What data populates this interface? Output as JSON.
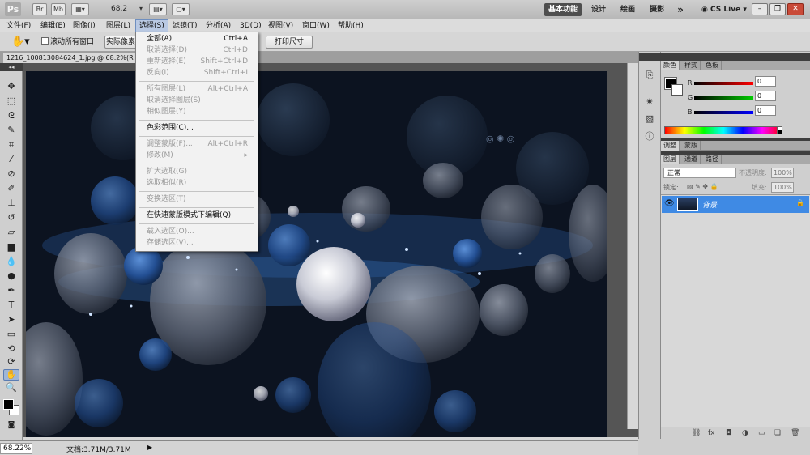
{
  "appbar": {
    "logo": "Ps",
    "br_label": "Br",
    "mb_label": "Mb",
    "zoom": "68.2",
    "workspaces": [
      "基本功能",
      "设计",
      "绘画",
      "摄影"
    ],
    "more": "»",
    "cslive": "CS Live"
  },
  "menubar": {
    "items": [
      "文件(F)",
      "编辑(E)",
      "图像(I)",
      "图层(L)",
      "选择(S)",
      "滤镜(T)",
      "分析(A)",
      "3D(D)",
      "视图(V)",
      "窗口(W)",
      "帮助(H)"
    ]
  },
  "options": {
    "scroll_all_windows": "滚动所有窗口",
    "actual_pixels": "实际像素",
    "print_size": "打印尺寸"
  },
  "document": {
    "tab_title": "1216_100813084624_1.jpg @ 68.2%(R"
  },
  "select_menu": {
    "groups": [
      [
        {
          "label": "全部(A)",
          "shortcut": "Ctrl+A",
          "enabled": true
        },
        {
          "label": "取消选择(D)",
          "shortcut": "Ctrl+D",
          "enabled": false
        },
        {
          "label": "重新选择(E)",
          "shortcut": "Shift+Ctrl+D",
          "enabled": false
        },
        {
          "label": "反向(I)",
          "shortcut": "Shift+Ctrl+I",
          "enabled": false
        }
      ],
      [
        {
          "label": "所有图层(L)",
          "shortcut": "Alt+Ctrl+A",
          "enabled": false
        },
        {
          "label": "取消选择图层(S)",
          "shortcut": "",
          "enabled": false
        },
        {
          "label": "相似图层(Y)",
          "shortcut": "",
          "enabled": false
        }
      ],
      [
        {
          "label": "色彩范围(C)...",
          "shortcut": "",
          "enabled": true
        }
      ],
      [
        {
          "label": "调整蒙版(F)...",
          "shortcut": "Alt+Ctrl+R",
          "enabled": false
        },
        {
          "label": "修改(M)",
          "shortcut": "▸",
          "enabled": false
        }
      ],
      [
        {
          "label": "扩大选取(G)",
          "shortcut": "",
          "enabled": false
        },
        {
          "label": "选取相似(R)",
          "shortcut": "",
          "enabled": false
        }
      ],
      [
        {
          "label": "变换选区(T)",
          "shortcut": "",
          "enabled": false
        }
      ],
      [
        {
          "label": "在快速蒙版模式下编辑(Q)",
          "shortcut": "",
          "enabled": true
        }
      ],
      [
        {
          "label": "载入选区(O)...",
          "shortcut": "",
          "enabled": false
        },
        {
          "label": "存储选区(V)...",
          "shortcut": "",
          "enabled": false
        }
      ]
    ]
  },
  "color_panel": {
    "tabs": [
      "颜色",
      "样式",
      "色板"
    ],
    "channels": [
      {
        "name": "R",
        "value": "0"
      },
      {
        "name": "G",
        "value": "0"
      },
      {
        "name": "B",
        "value": "0"
      }
    ]
  },
  "adjust_panel": {
    "tabs": [
      "调整",
      "蒙版"
    ]
  },
  "layers_panel": {
    "tabs": [
      "图层",
      "通道",
      "路径"
    ],
    "blend_mode": "正常",
    "opacity_label": "不透明度:",
    "opacity_value": "100%",
    "lock_label": "锁定:",
    "fill_label": "填充:",
    "fill_value": "100%",
    "layers": [
      {
        "name": "背景",
        "locked": true
      }
    ]
  },
  "status": {
    "zoom": "68.22%",
    "doc_info": "文档:3.71M/3.71M"
  },
  "colors": {
    "menu_highlight": "#b9c9e3",
    "layer_selected": "#3f8ae4",
    "workspace_active": "#4e4e4e"
  }
}
